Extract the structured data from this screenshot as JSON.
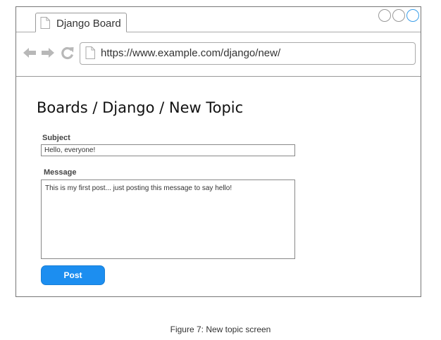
{
  "browser": {
    "tab_title": "Django Board",
    "url": "https://www.example.com/django/new/",
    "icons": {
      "back": "arrow-left-icon",
      "forward": "arrow-right-icon",
      "reload": "reload-icon",
      "page": "document-icon"
    },
    "colors": {
      "icon_gray": "#b8b8b8",
      "active_control": "#3b9ee8"
    }
  },
  "page": {
    "breadcrumb": "Boards / Django / New Topic",
    "form": {
      "subject_label": "Subject",
      "subject_value": "Hello, everyone!",
      "message_label": "Message",
      "message_value": "This is my first post... just posting this message to say hello!",
      "submit_label": "Post",
      "submit_color": "#1c8ef0"
    }
  },
  "caption": "Figure 7: New topic screen"
}
